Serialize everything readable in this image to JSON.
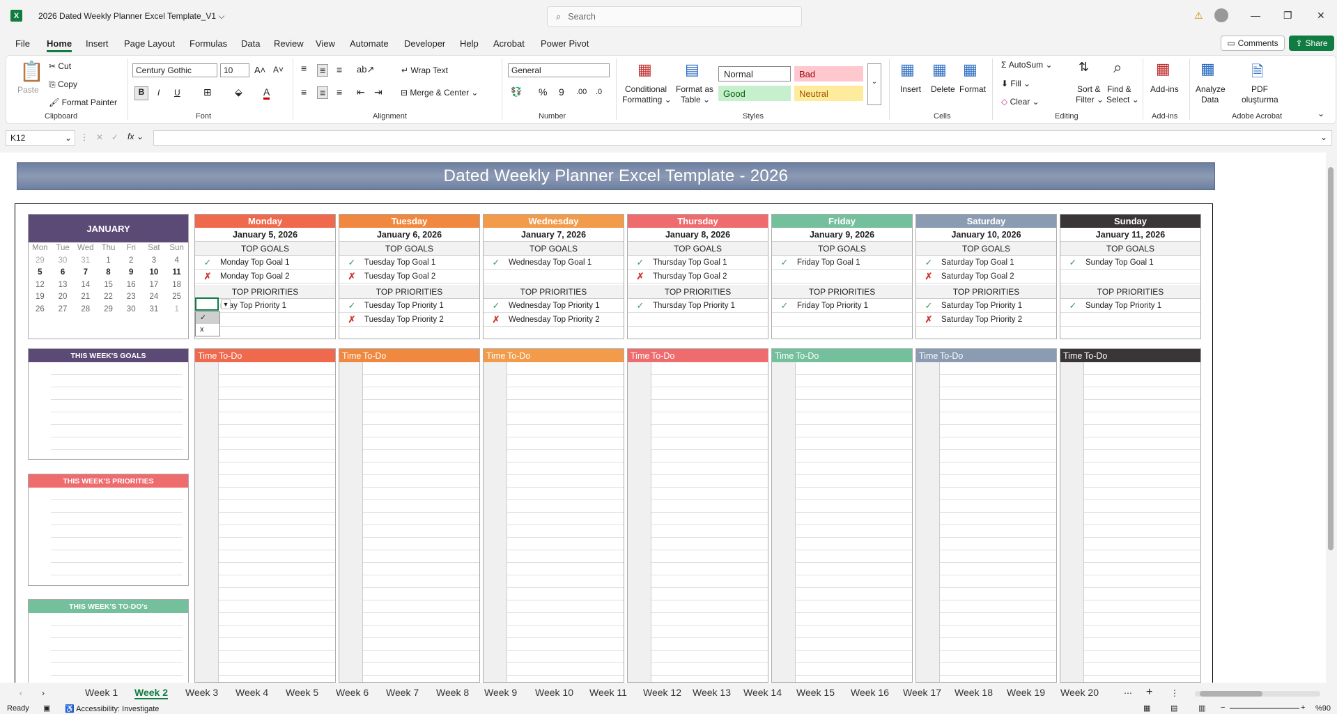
{
  "titlebar": {
    "app_icon": "X",
    "doc_title": "2026 Dated Weekly Planner Excel Template_V1",
    "search_placeholder": "Search"
  },
  "menu": [
    "File",
    "Home",
    "Insert",
    "Page Layout",
    "Formulas",
    "Data",
    "Review",
    "View",
    "Automate",
    "Developer",
    "Help",
    "Acrobat",
    "Power Pivot"
  ],
  "comments_label": "Comments",
  "share_label": "Share",
  "ribbon": {
    "clipboard": {
      "paste": "Paste",
      "cut": "Cut",
      "copy": "Copy",
      "format_painter": "Format Painter",
      "label": "Clipboard"
    },
    "font": {
      "name": "Century Gothic",
      "size": "10",
      "label": "Font"
    },
    "alignment": {
      "wrap": "Wrap Text",
      "merge": "Merge & Center",
      "label": "Alignment"
    },
    "number": {
      "format": "General",
      "label": "Number"
    },
    "styles": {
      "conditional": "Conditional",
      "conditional2": "Formatting",
      "format_table": "Format as",
      "format_table2": "Table",
      "normal": "Normal",
      "bad": "Bad",
      "good": "Good",
      "neutral": "Neutral",
      "label": "Styles"
    },
    "cells": {
      "insert": "Insert",
      "delete": "Delete",
      "format": "Format",
      "label": "Cells"
    },
    "editing": {
      "autosum": "AutoSum",
      "fill": "Fill",
      "clear": "Clear",
      "sort": "Sort &",
      "sort2": "Filter",
      "find": "Find &",
      "find2": "Select",
      "label": "Editing"
    },
    "addins": {
      "addins": "Add-ins",
      "label": "Add-ins"
    },
    "analyze": {
      "l1": "Analyze",
      "l2": "Data"
    },
    "acrobat": {
      "l1": "PDF",
      "l2": "oluşturma",
      "label": "Adobe Acrobat"
    }
  },
  "formula_bar": {
    "cell_ref": "K12",
    "fx": "fx",
    "value": ""
  },
  "banner_title": "Dated Weekly Planner Excel Template - 2026",
  "calendar": {
    "month": "JANUARY",
    "days": [
      "Mon",
      "Tue",
      "Wed",
      "Thu",
      "Fri",
      "Sat",
      "Sun"
    ],
    "weeks": [
      [
        "29",
        "30",
        "31",
        "1",
        "2",
        "3",
        "4"
      ],
      [
        "5",
        "6",
        "7",
        "8",
        "9",
        "10",
        "11"
      ],
      [
        "12",
        "13",
        "14",
        "15",
        "16",
        "17",
        "18"
      ],
      [
        "19",
        "20",
        "21",
        "22",
        "23",
        "24",
        "25"
      ],
      [
        "26",
        "27",
        "28",
        "29",
        "30",
        "31",
        "1"
      ]
    ]
  },
  "side_boxes": {
    "goals": "THIS WEEK'S GOALS",
    "priorities": "THIS WEEK'S PRIORITIES",
    "todos": "THIS WEEK'S TO-DO's"
  },
  "section_labels": {
    "goals": "TOP GOALS",
    "priorities": "TOP PRIORITIES",
    "time": "Time",
    "todo": "To-Do"
  },
  "days": [
    {
      "name": "Monday",
      "date": "January 5, 2026",
      "color": "#ef6a4c",
      "goals": [
        {
          "mark": "✓",
          "text": "Monday Top Goal 1"
        },
        {
          "mark": "✗",
          "text": "Monday Top Goal 2"
        }
      ],
      "priorities": [
        {
          "mark": "",
          "text": "nday Top Priority 1"
        },
        {
          "mark": "",
          "text": ""
        }
      ]
    },
    {
      "name": "Tuesday",
      "date": "January 6, 2026",
      "color": "#f0883f",
      "goals": [
        {
          "mark": "✓",
          "text": "Tuesday Top Goal 1"
        },
        {
          "mark": "✗",
          "text": "Tuesday Top Goal 2"
        }
      ],
      "priorities": [
        {
          "mark": "✓",
          "text": "Tuesday Top Priority 1"
        },
        {
          "mark": "✗",
          "text": "Tuesday Top Priority 2"
        }
      ]
    },
    {
      "name": "Wednesday",
      "date": "January 7, 2026",
      "color": "#f29b4b",
      "goals": [
        {
          "mark": "✓",
          "text": "Wednesday Top Goal 1"
        },
        {
          "mark": "",
          "text": ""
        }
      ],
      "priorities": [
        {
          "mark": "✓",
          "text": "Wednesday Top Priority 1"
        },
        {
          "mark": "✗",
          "text": "Wednesday Top Priority 2"
        }
      ]
    },
    {
      "name": "Thursday",
      "date": "January 8, 2026",
      "color": "#ee6b6e",
      "goals": [
        {
          "mark": "✓",
          "text": "Thursday Top Goal 1"
        },
        {
          "mark": "✗",
          "text": "Thursday Top Goal 2"
        }
      ],
      "priorities": [
        {
          "mark": "✓",
          "text": "Thursday Top Priority 1"
        },
        {
          "mark": "",
          "text": ""
        }
      ]
    },
    {
      "name": "Friday",
      "date": "January 9, 2026",
      "color": "#74bf9c",
      "goals": [
        {
          "mark": "✓",
          "text": "Friday Top Goal 1"
        },
        {
          "mark": "",
          "text": ""
        }
      ],
      "priorities": [
        {
          "mark": "✓",
          "text": "Friday Top Priority 1"
        },
        {
          "mark": "",
          "text": ""
        }
      ]
    },
    {
      "name": "Saturday",
      "date": "January 10, 2026",
      "color": "#8a9bb2",
      "goals": [
        {
          "mark": "✓",
          "text": "Saturday Top Goal 1"
        },
        {
          "mark": "✗",
          "text": "Saturday Top Goal 2"
        }
      ],
      "priorities": [
        {
          "mark": "✓",
          "text": "Saturday Top Priority 1"
        },
        {
          "mark": "✗",
          "text": "Saturday Top Priority 2"
        }
      ]
    },
    {
      "name": "Sunday",
      "date": "January 11, 2026",
      "color": "#3a3536",
      "goals": [
        {
          "mark": "✓",
          "text": "Sunday Top Goal 1"
        },
        {
          "mark": "",
          "text": ""
        }
      ],
      "priorities": [
        {
          "mark": "✓",
          "text": "Sunday Top Priority 1"
        },
        {
          "mark": "",
          "text": ""
        }
      ]
    }
  ],
  "dropdown": {
    "options": [
      "✓",
      "x"
    ]
  },
  "tabs": [
    "Week 1",
    "Week 2",
    "Week 3",
    "Week 4",
    "Week 5",
    "Week 6",
    "Week 7",
    "Week 8",
    "Week 9",
    "Week 10",
    "Week 11",
    "Week 12",
    "Week 13",
    "Week 14",
    "Week 15",
    "Week 16",
    "Week 17",
    "Week 18",
    "Week 19",
    "Week 20"
  ],
  "active_tab": "Week 2",
  "status": {
    "ready": "Ready",
    "accessibility": "Accessibility: Investigate",
    "zoom": "%90"
  },
  "colors": {
    "goals_box": "#5b4a75",
    "priorities_box": "#ee6b6e",
    "todos_box": "#74bf9c",
    "excel_green": "#107c41"
  }
}
